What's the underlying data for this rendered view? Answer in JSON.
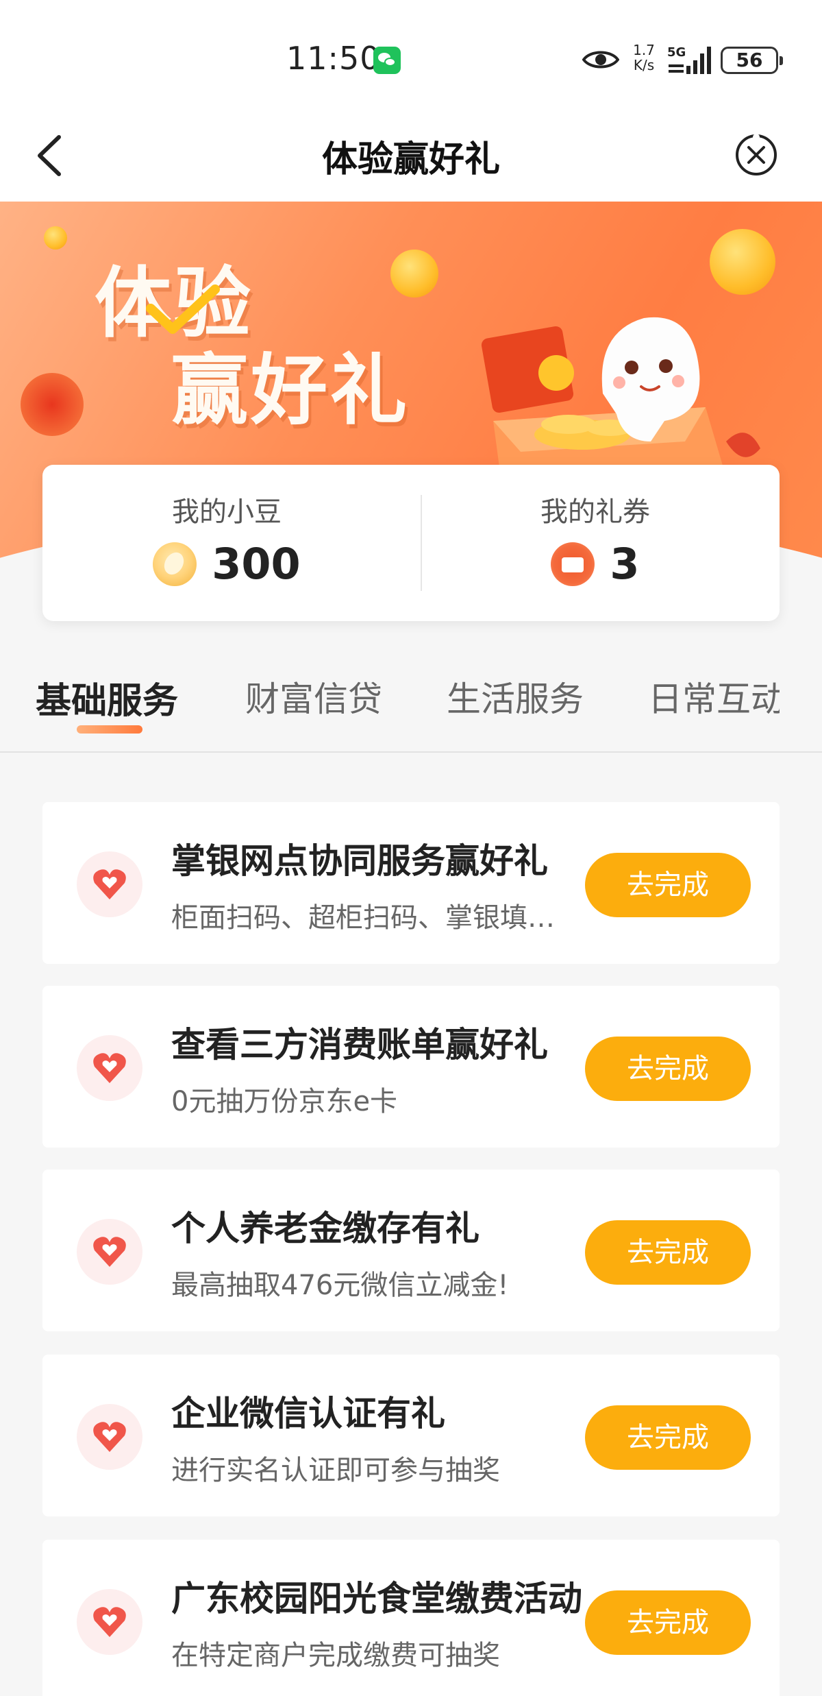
{
  "status_bar": {
    "time": "11:50",
    "net_speed_value": "1.7",
    "net_speed_unit": "K/s",
    "network_type": "5G",
    "battery": "56",
    "icons": [
      "wechat-icon",
      "eye-icon",
      "signal-icon",
      "battery-icon"
    ]
  },
  "nav": {
    "title": "体验赢好礼",
    "icons": [
      "back-arrow-icon",
      "close-circle-icon"
    ]
  },
  "banner": {
    "title_line1": "体验",
    "title_line2": "赢好礼"
  },
  "stats": {
    "beans_label": "我的小豆",
    "beans_value": "300",
    "coupons_label": "我的礼券",
    "coupons_value": "3"
  },
  "tabs": [
    {
      "label": "基础服务",
      "active": true
    },
    {
      "label": "财富信贷",
      "active": false
    },
    {
      "label": "生活服务",
      "active": false
    },
    {
      "label": "日常互动",
      "active": false
    }
  ],
  "tasks": [
    {
      "title": "掌银网点协同服务赢好礼",
      "desc": "柜面扫码、超柜扫码、掌银填单赢好礼",
      "button": "去完成"
    },
    {
      "title": "查看三方消费账单赢好礼",
      "desc": "0元抽万份京东e卡",
      "button": "去完成"
    },
    {
      "title": "个人养老金缴存有礼",
      "desc": "最高抽取476元微信立减金!",
      "button": "去完成"
    },
    {
      "title": "企业微信认证有礼",
      "desc": "进行实名认证即可参与抽奖",
      "button": "去完成"
    },
    {
      "title": "广东校园阳光食堂缴费活动",
      "desc": "在特定商户完成缴费可抽奖",
      "button": "去完成"
    }
  ],
  "colors": {
    "accent_orange": "#ff7d43",
    "button_yellow": "#fcad0d",
    "heart_red": "#f0564a"
  }
}
